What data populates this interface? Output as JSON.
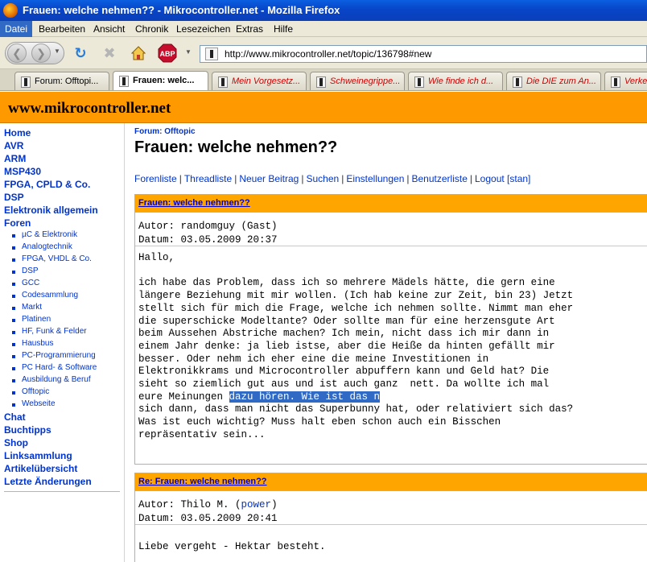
{
  "window": {
    "title": "Frauen: welche nehmen?? - Mikrocontroller.net - Mozilla Firefox"
  },
  "menu": [
    "Datei",
    "Bearbeiten",
    "Ansicht",
    "Chronik",
    "Lesezeichen",
    "Extras",
    "Hilfe"
  ],
  "navbar": {
    "url": "http://www.mikrocontroller.net/topic/136798#new"
  },
  "tabs": [
    {
      "label": "Forum: Offtopi..."
    },
    {
      "label": "Frauen: welc..."
    },
    {
      "label": "Mein Vorgesetz..."
    },
    {
      "label": "Schweinegrippe..."
    },
    {
      "label": "Wie finde ich d..."
    },
    {
      "label": "Die DIE zum An..."
    },
    {
      "label": "Verke"
    }
  ],
  "site": {
    "name": "www.mikrocontroller.net"
  },
  "sidebar": {
    "top": [
      "Home",
      "AVR",
      "ARM",
      "MSP430",
      "FPGA, CPLD & Co.",
      "DSP",
      "Elektronik allgemein",
      "Foren"
    ],
    "sub": [
      "µC & Elektronik",
      "Analogtechnik",
      "FPGA, VHDL & Co.",
      "DSP",
      "GCC",
      "Codesammlung",
      "Markt",
      "Platinen",
      "HF, Funk & Felder",
      "Hausbus",
      "PC-Programmierung",
      "PC Hard- & Software",
      "Ausbildung & Beruf",
      "Offtopic",
      "Webseite"
    ],
    "bottom": [
      "Chat",
      "Buchtipps",
      "Shop",
      "Linksammlung",
      "Artikelübersicht",
      "Letzte Änderungen"
    ]
  },
  "page": {
    "breadcrumb": "Forum: Offtopic",
    "title": "Frauen: welche nehmen??",
    "navlinks": [
      "Forenliste",
      "Threadliste",
      "Neuer Beitrag",
      "Suchen",
      "Einstellungen",
      "Benutzerliste",
      "Logout [stan]"
    ]
  },
  "posts": [
    {
      "subject": "Frauen: welche nehmen??",
      "author_label": "Autor: ",
      "author": "randomguy (Gast)",
      "date": "Datum: 03.05.2009 20:37",
      "body_before": "Hallo,\n\nich habe das Problem, dass ich so mehrere Mädels hätte, die gern eine\nlängere Beziehung mit mir wollen. (Ich hab keine zur Zeit, bin 23) Jetzt\nstellt sich für mich die Frage, welche ich nehmen sollte. Nimmt man eher\ndie superschicke Modeltante? Oder sollte man für eine herzensgute Art\nbeim Aussehen Abstriche machen? Ich mein, nicht dass ich mir dann in\neinem Jahr denke: ja lieb istse, aber die Heiße da hinten gefällt mir\nbesser. Oder nehm ich eher eine die meine Investitionen in\nElektronikkrams und Microcontroller abpuffern kann und Geld hat? Die\nsieht so ziemlich gut aus und ist auch ganz  nett. Da wollte ich mal\neure Meinungen ",
      "body_selected": "dazu hören. Wie ist das n",
      "body_after": "\nsich dann, dass man nicht das Superbunny hat, oder relativiert sich das?\nWas ist euch wichtig? Muss halt eben schon auch ein Bisschen\nrepräsentativ sein..."
    },
    {
      "subject": "Re: Frauen: welche nehmen??",
      "author_label": "Autor: ",
      "author_name": "Thilo M.",
      "author_user": "power",
      "date": "Datum: 03.05.2009 20:41",
      "body": "Liebe vergeht - Hektar besteht."
    }
  ],
  "colors": {
    "accent": "#ff9900",
    "link": "#0033cc",
    "selection": "#316ac5"
  }
}
